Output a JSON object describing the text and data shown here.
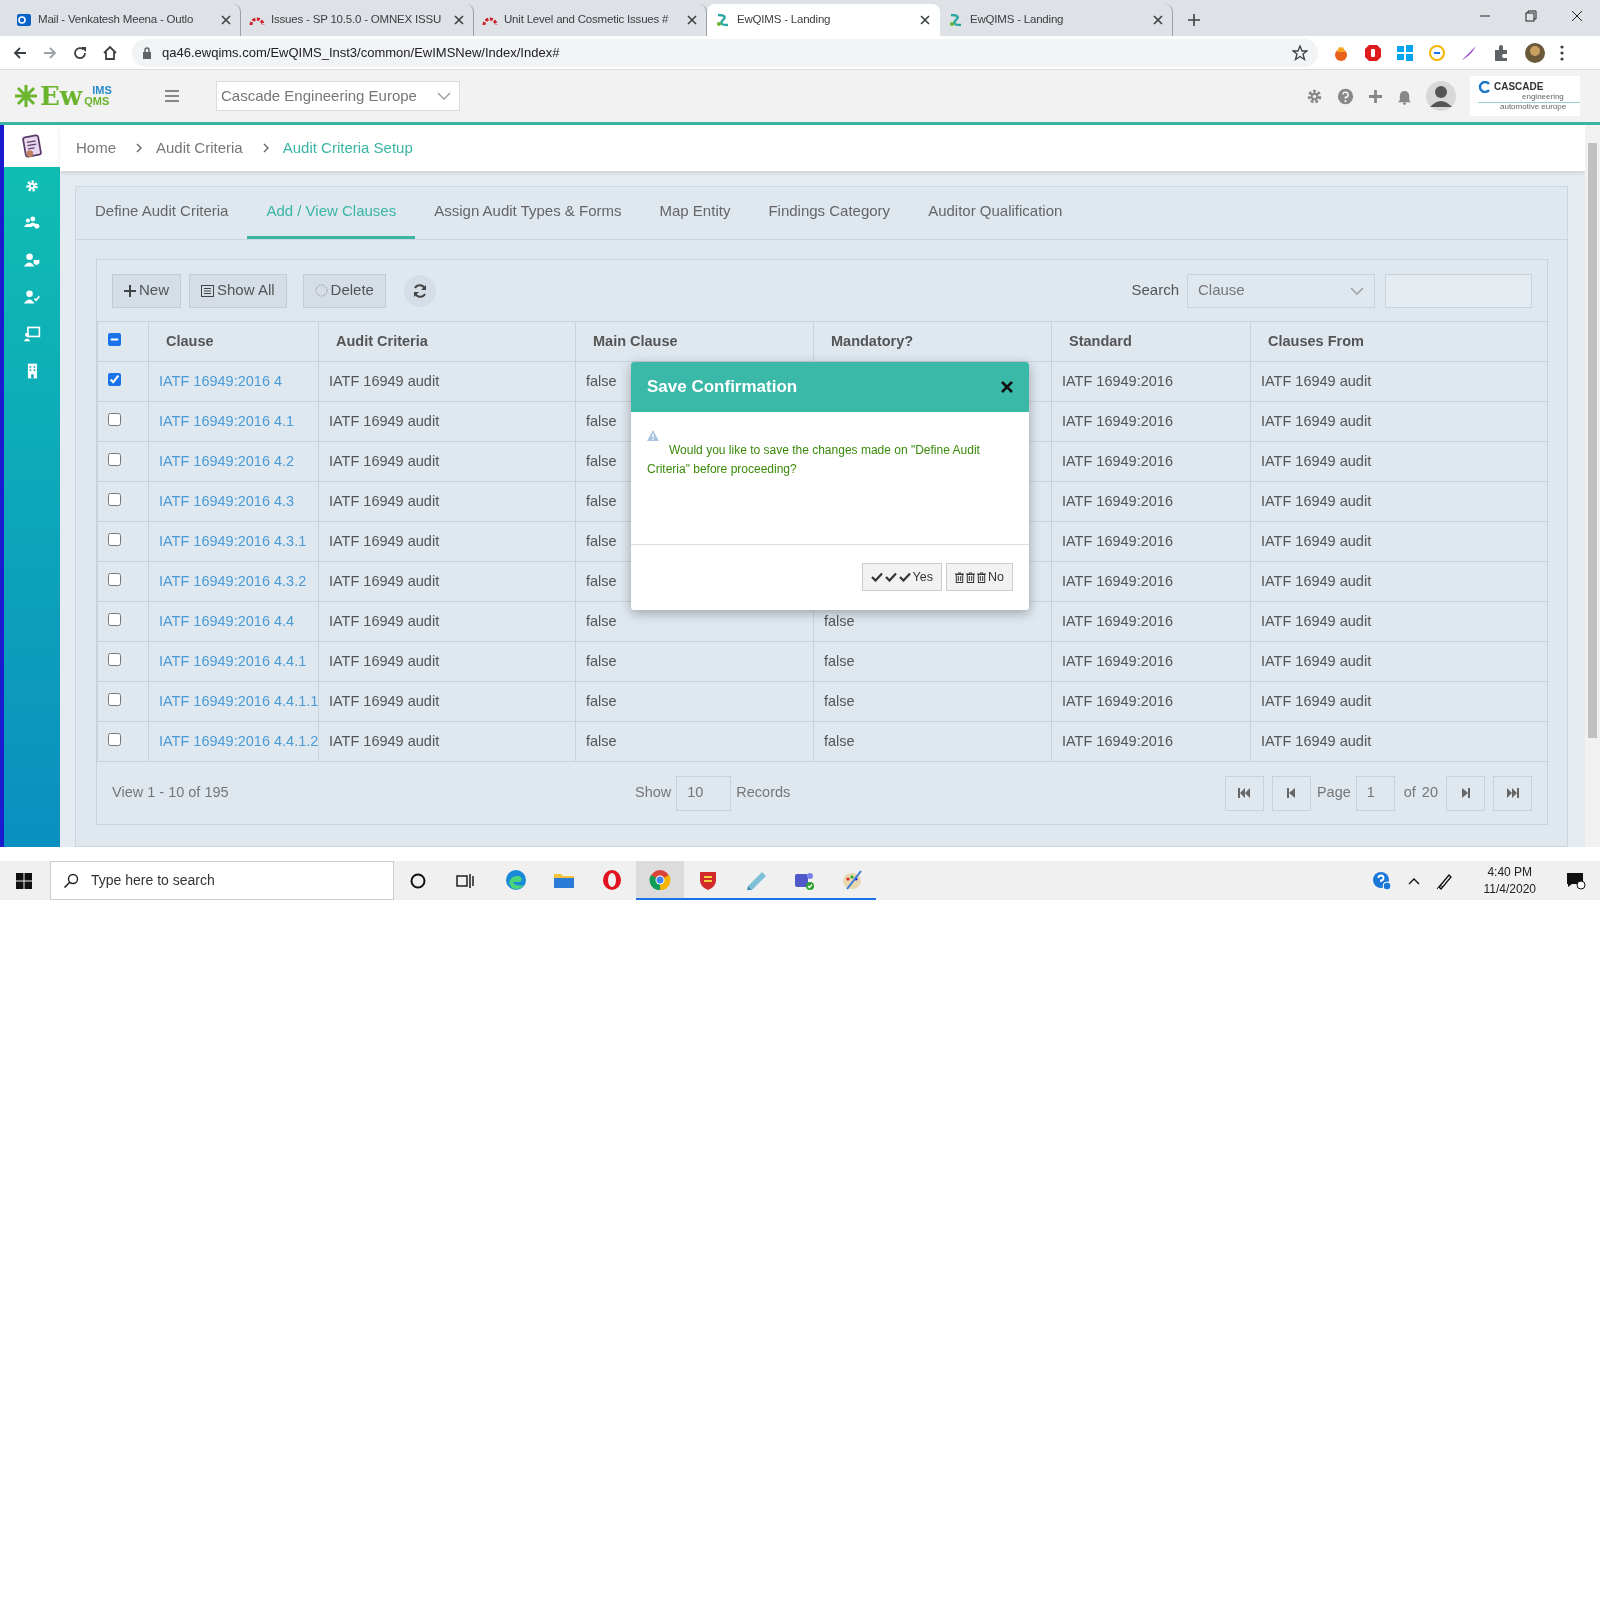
{
  "browser": {
    "tabs": [
      {
        "title": "Mail - Venkatesh Meena - Outlo",
        "kind": "outlook",
        "selected": false
      },
      {
        "title": "Issues - SP 10.5.0 - OMNEX ISSU",
        "kind": "issues",
        "selected": false
      },
      {
        "title": "Unit Level and Cosmetic Issues #",
        "kind": "issues",
        "selected": false
      },
      {
        "title": "EwQIMS - Landing",
        "kind": "ewqims",
        "selected": true
      },
      {
        "title": "EwQIMS - Landing",
        "kind": "ewqims",
        "selected": false
      }
    ],
    "url": "qa46.ewqims.com/EwQIMS_Inst3/common/EwIMSNew/Index/Index#"
  },
  "app_header": {
    "logo": {
      "main": "Ew",
      "top": "IMS",
      "bottom": "QMS"
    },
    "company_select": "Cascade Engineering Europe",
    "client_logo": {
      "name": "CASCADE",
      "line_1": "engineering",
      "line_2": "automotive europe"
    }
  },
  "sidebar": {
    "items": [
      {
        "kind": "clipboard",
        "selected": true
      },
      {
        "kind": "gear",
        "selected": false
      },
      {
        "kind": "users",
        "selected": false
      },
      {
        "kind": "user-shield",
        "selected": false
      },
      {
        "kind": "user-check",
        "selected": false
      },
      {
        "kind": "presentation",
        "selected": false
      },
      {
        "kind": "building",
        "selected": false
      }
    ]
  },
  "breadcrumbs": [
    {
      "label": "Home",
      "current": false
    },
    {
      "label": "Audit Criteria",
      "current": false
    },
    {
      "label": "Audit Criteria Setup",
      "current": true
    }
  ],
  "tabs": [
    {
      "label": "Define Audit Criteria",
      "selected": false
    },
    {
      "label": "Add / View Clauses",
      "selected": true
    },
    {
      "label": "Assign Audit Types & Forms",
      "selected": false
    },
    {
      "label": "Map Entity",
      "selected": false
    },
    {
      "label": "Findings Category",
      "selected": false
    },
    {
      "label": "Auditor Qualification",
      "selected": false
    }
  ],
  "toolbar": {
    "buttons": [
      {
        "kind": "new",
        "label": "New"
      },
      {
        "kind": "list",
        "label": "Show All"
      },
      {
        "kind": "delete",
        "label": "Delete"
      },
      {
        "kind": "refresh"
      }
    ],
    "search_label": "Search",
    "search_by": "Clause"
  },
  "table": {
    "select_all": {
      "indeterminate": true
    },
    "columns": [
      "Clause",
      "Audit Criteria",
      "Main Clause",
      "Mandatory?",
      "Standard",
      "Clauses From"
    ],
    "rows": [
      {
        "checked": true,
        "clause": "IATF 16949:2016 4",
        "audit_criteria": "IATF 16949 audit",
        "main_clause": "false",
        "standard": "IATF 16949:2016",
        "clauses_from": "IATF 16949 audit"
      },
      {
        "checked": false,
        "clause": "IATF 16949:2016 4.1",
        "audit_criteria": "IATF 16949 audit",
        "main_clause": "false",
        "standard": "IATF 16949:2016",
        "clauses_from": "IATF 16949 audit"
      },
      {
        "checked": false,
        "clause": "IATF 16949:2016 4.2",
        "audit_criteria": "IATF 16949 audit",
        "main_clause": "false",
        "standard": "IATF 16949:2016",
        "clauses_from": "IATF 16949 audit"
      },
      {
        "checked": false,
        "clause": "IATF 16949:2016 4.3",
        "audit_criteria": "IATF 16949 audit",
        "main_clause": "false",
        "standard": "IATF 16949:2016",
        "clauses_from": "IATF 16949 audit"
      },
      {
        "checked": false,
        "clause": "IATF 16949:2016 4.3.1",
        "audit_criteria": "IATF 16949 audit",
        "main_clause": "false",
        "standard": "IATF 16949:2016",
        "clauses_from": "IATF 16949 audit"
      },
      {
        "checked": false,
        "clause": "IATF 16949:2016 4.3.2",
        "audit_criteria": "IATF 16949 audit",
        "main_clause": "false",
        "standard": "IATF 16949:2016",
        "clauses_from": "IATF 16949 audit"
      },
      {
        "checked": false,
        "clause": "IATF 16949:2016 4.4",
        "audit_criteria": "IATF 16949 audit",
        "main_clause": "false",
        "mandatory": "false",
        "standard": "IATF 16949:2016",
        "clauses_from": "IATF 16949 audit"
      },
      {
        "checked": false,
        "clause": "IATF 16949:2016 4.4.1",
        "audit_criteria": "IATF 16949 audit",
        "main_clause": "false",
        "mandatory": "false",
        "standard": "IATF 16949:2016",
        "clauses_from": "IATF 16949 audit"
      },
      {
        "checked": false,
        "clause": "IATF 16949:2016 4.4.1.1",
        "audit_criteria": "IATF 16949 audit",
        "main_clause": "false",
        "mandatory": "false",
        "standard": "IATF 16949:2016",
        "clauses_from": "IATF 16949 audit"
      },
      {
        "checked": false,
        "clause": "IATF 16949:2016 4.4.1.2",
        "audit_criteria": "IATF 16949 audit",
        "main_clause": "false",
        "mandatory": "false",
        "standard": "IATF 16949:2016",
        "clauses_from": "IATF 16949 audit"
      }
    ]
  },
  "pager": {
    "summary": "View 1 - 10 of 195",
    "show_label": "Show",
    "page_size": "10",
    "records_label": "Records",
    "page_label": "Page",
    "page": "1",
    "of_label": "of",
    "page_count": "20"
  },
  "dialog": {
    "title": "Save Confirmation",
    "message": "Would you like to save the changes made on \"Define Audit Criteria\" before proceeding?",
    "buttons": [
      {
        "kind": "yes",
        "label": "Yes"
      },
      {
        "kind": "no",
        "label": "No"
      }
    ]
  },
  "taskbar": {
    "search_placeholder": "Type here to search",
    "apps": [
      {
        "kind": "edge",
        "running": false,
        "selected": false
      },
      {
        "kind": "folder",
        "running": false,
        "selected": false
      },
      {
        "kind": "opera",
        "running": false,
        "selected": false
      },
      {
        "kind": "chrome",
        "running": true,
        "selected": true
      },
      {
        "kind": "shield",
        "running": true,
        "selected": false
      },
      {
        "kind": "notepad",
        "running": true,
        "selected": false
      },
      {
        "kind": "teams",
        "running": true,
        "selected": false
      },
      {
        "kind": "paint",
        "running": true,
        "selected": false
      }
    ],
    "time": "4:40 PM",
    "date": "11/4/2020"
  }
}
